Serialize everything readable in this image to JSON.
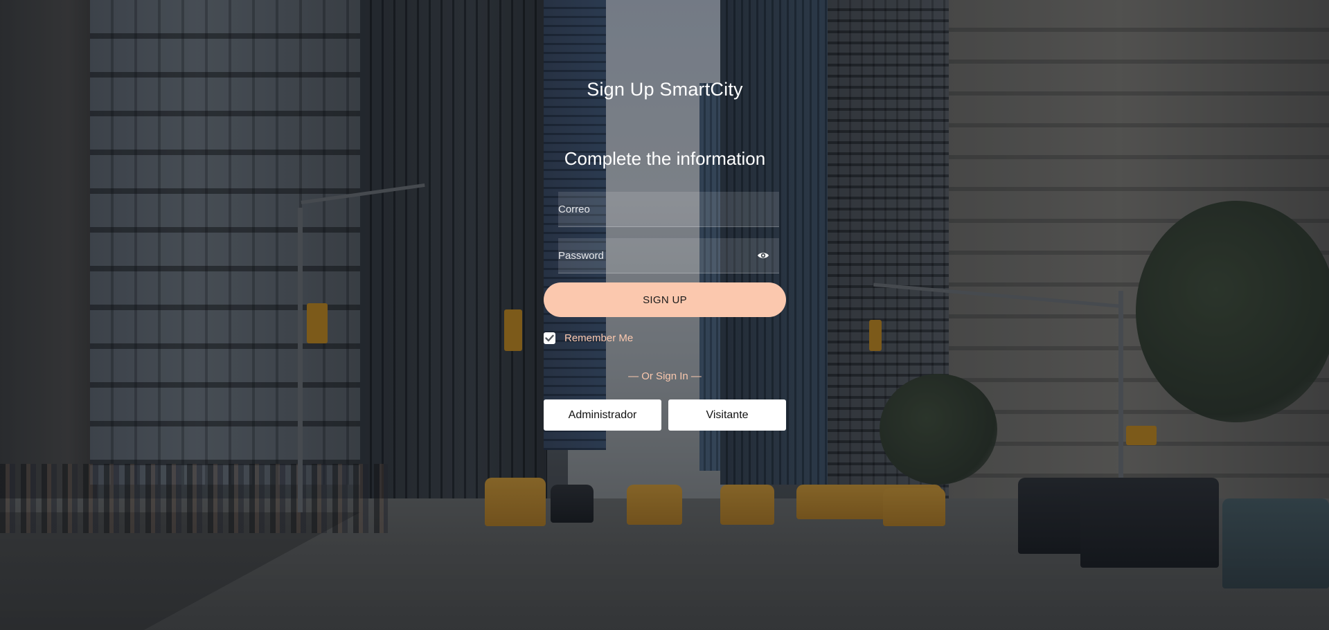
{
  "page": {
    "title": "Sign Up SmartCity",
    "subtitle": "Complete the information"
  },
  "form": {
    "email_placeholder": "Correo",
    "email_value": "",
    "password_placeholder": "Password",
    "password_value": "",
    "signup_label": "SIGN UP",
    "remember_label": "Remember Me",
    "remember_checked": true,
    "divider_text": "— Or Sign In —"
  },
  "roles": {
    "admin_label": "Administrador",
    "visitor_label": "Visitante"
  },
  "icons": {
    "password_toggle": "eye-icon",
    "checkbox": "check-icon"
  },
  "colors": {
    "accent": "#fbc8ae",
    "text_light": "#ffffff",
    "button_white": "#ffffff"
  }
}
